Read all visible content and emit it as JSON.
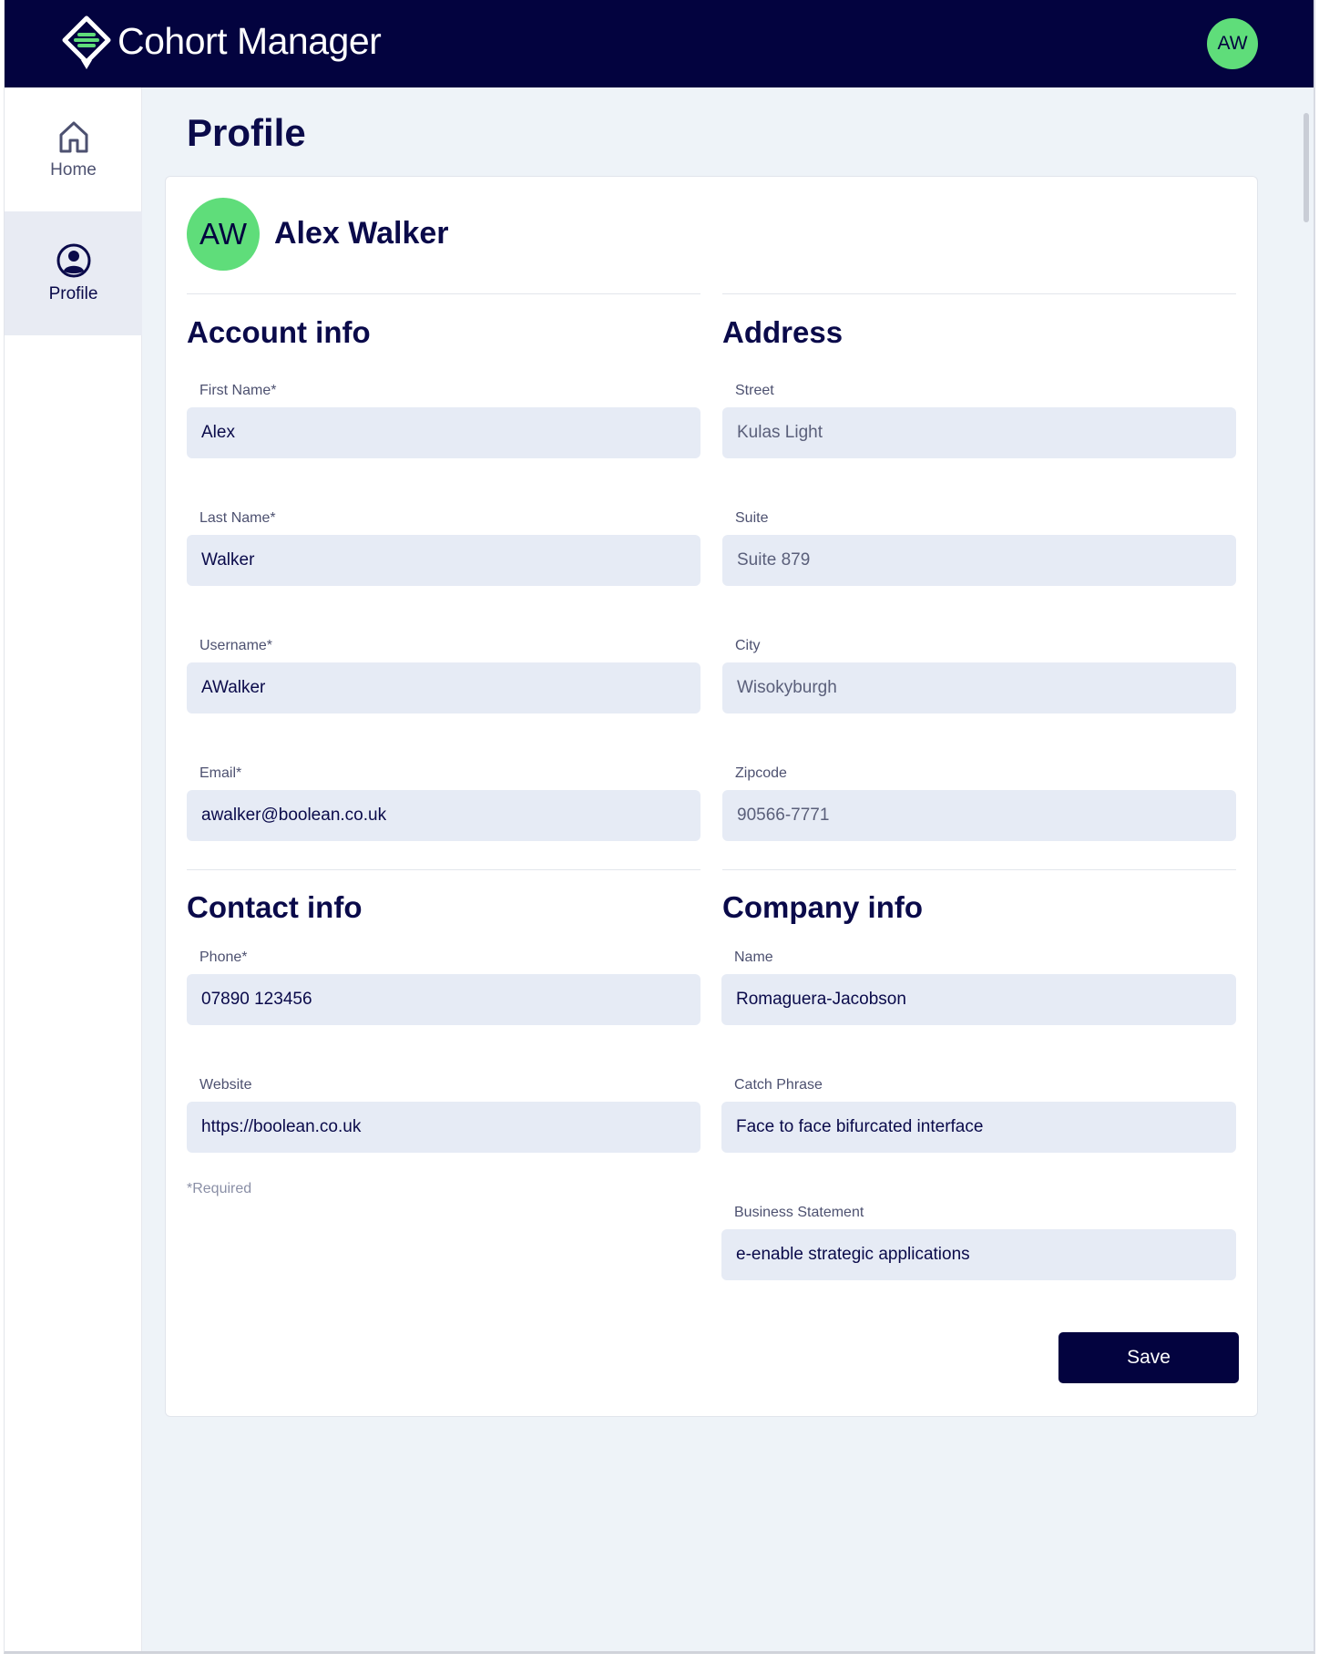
{
  "header": {
    "app_title": "Cohort Manager",
    "user_initials": "AW",
    "brand_color": "#03033f",
    "accent_color": "#5fdd7a"
  },
  "sidebar": {
    "items": [
      {
        "label": "Home",
        "icon": "home-icon",
        "active": false
      },
      {
        "label": "Profile",
        "icon": "user-circle-icon",
        "active": true
      }
    ]
  },
  "page": {
    "title": "Profile"
  },
  "profile": {
    "initials": "AW",
    "full_name": "Alex Walker"
  },
  "account_info": {
    "title": "Account info",
    "first_name": {
      "label": "First Name*",
      "value": "Alex"
    },
    "last_name": {
      "label": "Last Name*",
      "value": "Walker"
    },
    "username": {
      "label": "Username*",
      "value": "AWalker"
    },
    "email": {
      "label": "Email*",
      "value": "awalker@boolean.co.uk"
    }
  },
  "address": {
    "title": "Address",
    "street": {
      "label": "Street",
      "value": "Kulas Light"
    },
    "suite": {
      "label": "Suite",
      "value": "Suite 879"
    },
    "city": {
      "label": "City",
      "value": "Wisokyburgh"
    },
    "zipcode": {
      "label": "Zipcode",
      "value": "90566-7771"
    }
  },
  "contact_info": {
    "title": "Contact info",
    "phone": {
      "label": "Phone*",
      "value": "07890 123456"
    },
    "website": {
      "label": "Website",
      "value": "https://boolean.co.uk"
    }
  },
  "company_info": {
    "title": "Company info",
    "name": {
      "label": "Name",
      "value": "Romaguera-Jacobson"
    },
    "catch_phrase": {
      "label": "Catch Phrase",
      "value": "Face to face bifurcated interface"
    },
    "business_statement": {
      "label": "Business Statement",
      "value": "e-enable strategic applications"
    }
  },
  "form": {
    "required_note": "*Required",
    "save_label": "Save"
  }
}
